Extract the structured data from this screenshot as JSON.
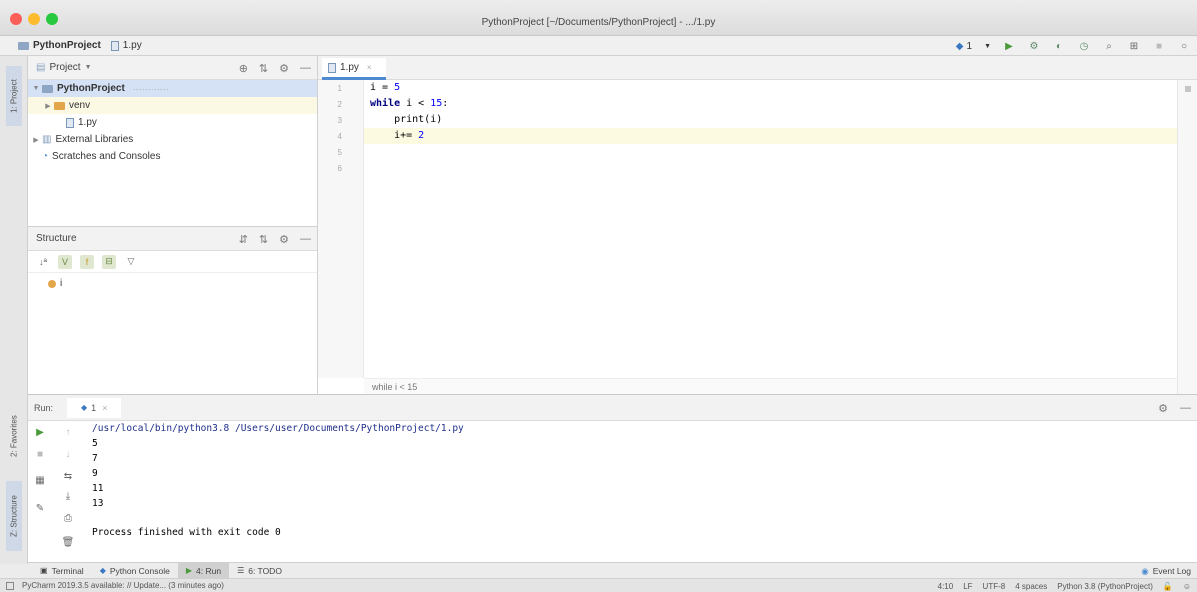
{
  "window": {
    "title": "PythonProject [~/Documents/PythonProject] - .../1.py"
  },
  "nav": {
    "project": "PythonProject",
    "file": "1.py",
    "run_config": "1"
  },
  "left_strip": {
    "project_tab": "1: Project",
    "favorites_tab": "2: Favorites",
    "structure_tab": "Z: Structure"
  },
  "project_panel": {
    "header": "Project",
    "tree": [
      {
        "label": "PythonProject",
        "bold": true
      },
      {
        "label": "venv"
      },
      {
        "label": "1.py"
      },
      {
        "label": "External Libraries"
      },
      {
        "label": "Scratches and Consoles"
      }
    ]
  },
  "structure_panel": {
    "header": "Structure",
    "item": "i"
  },
  "editor": {
    "tab": "1.py",
    "line_numbers": [
      "1",
      "2",
      "3",
      "4",
      "5",
      "6"
    ],
    "code": {
      "l1_var": "i",
      "l1_op": " = ",
      "l1_num": "5",
      "l2_kw": "while",
      "l2_rest": " i < ",
      "l2_num": "15",
      "l2_colon": ":",
      "l3": "    print(i)",
      "l4_code": "    i+= ",
      "l4_num": "2"
    },
    "breadcrumb": "while i < 15"
  },
  "run_panel": {
    "label": "Run:",
    "tab": "1",
    "command": "/usr/local/bin/python3.8 /Users/user/Documents/PythonProject/1.py",
    "output": [
      "5",
      "7",
      "9",
      "11",
      "13"
    ],
    "finished": "Process finished with exit code 0"
  },
  "tool_tabs": {
    "terminal": "Terminal",
    "python_console": "Python Console",
    "run": "4: Run",
    "todo": "6: TODO",
    "event_log": "Event Log"
  },
  "status": {
    "update": "PyCharm 2019.3.5 available: // Update... (3 minutes ago)",
    "position": "4:10",
    "line_sep": "LF",
    "encoding": "UTF-8",
    "indent": "4 spaces",
    "interpreter": "Python 3.8 (PythonProject)"
  },
  "colors": {
    "accent": "#4d8ad0",
    "keyword": "#000080",
    "number": "#0000ff",
    "run_green": "#4a9a3c"
  }
}
